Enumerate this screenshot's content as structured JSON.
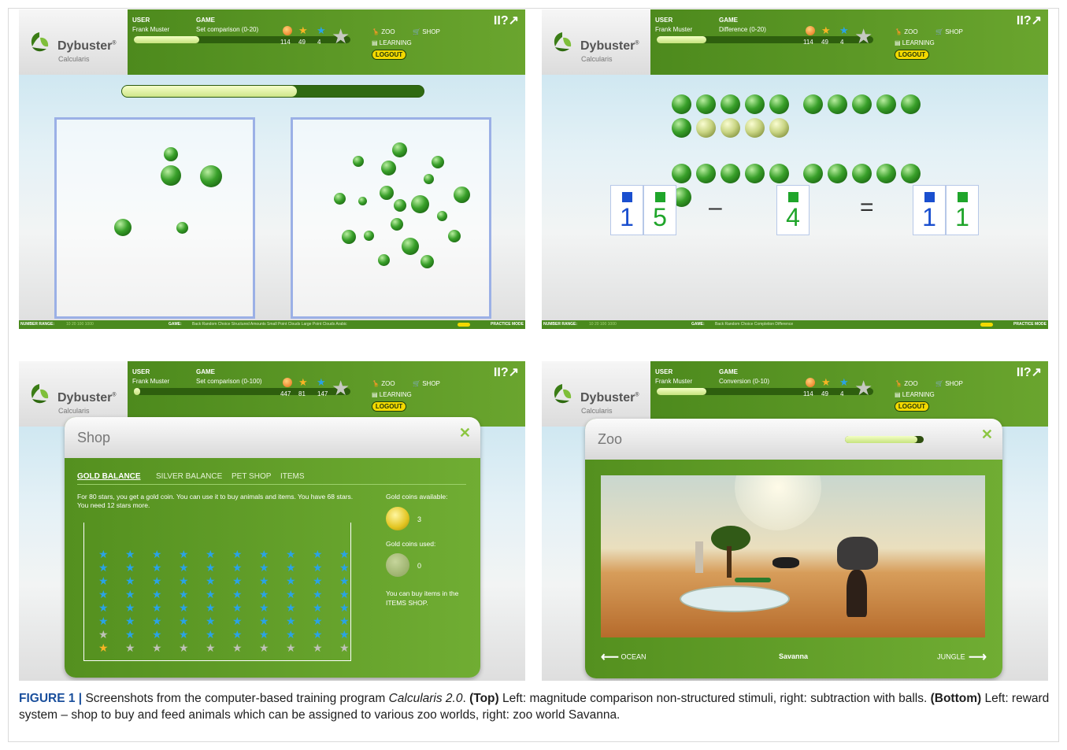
{
  "header": {
    "brand": "Dybuster",
    "brand_mark": "®",
    "subtitle": "Calcularis",
    "user_label": "USER",
    "game_label": "GAME",
    "zoo_label": "ZOO",
    "shop_label": "SHOP",
    "learning_label": "LEARNING",
    "logout_label": "LOGOUT",
    "corner_icons": "II?↗"
  },
  "panels": {
    "tl": {
      "user": "Frank Muster",
      "game": "Set comparison (0-20)",
      "coins": "114",
      "gold_stars": "49",
      "blue_stars": "4",
      "level_progress": 0.3,
      "task_progress": 0.58
    },
    "tr": {
      "user": "Frank Muster",
      "game": "Difference (0-20)",
      "coins": "114",
      "gold_stars": "49",
      "blue_stars": "4",
      "level_progress": 0.23
    },
    "bl": {
      "user": "Frank Muster",
      "game": "Set comparison (0-100)",
      "coins": "447",
      "gold_stars": "81",
      "blue_stars": "147",
      "level_progress": 0.02
    },
    "br": {
      "user": "Frank Muster",
      "game": "Conversion (0-10)",
      "coins": "114",
      "gold_stars": "49",
      "blue_stars": "4",
      "level_progress": 0.23
    }
  },
  "footer_tl": {
    "range_label": "NUMBER RANGE:",
    "range_values": "10  20  100  1000",
    "game_label": "GAME:",
    "game_items": "Back    Random Choice    Structured Amounts    Small Point Clouds    Large Point Clouds    Arabic",
    "mode": "PRACTICE MODE"
  },
  "footer_tr": {
    "range_label": "NUMBER RANGE:",
    "range_values": "10  20  100  1000",
    "game_label": "GAME:",
    "game_items": "Back    Random Choice    Completion    Difference",
    "mode": "PRACTICE MODE"
  },
  "equation": {
    "a1": "1",
    "a2": "5",
    "minus": "–",
    "b": "4",
    "equals": "=",
    "r1": "1",
    "r2": "1"
  },
  "shop": {
    "title": "Shop",
    "tabs": [
      "GOLD BALANCE",
      "SILVER BALANCE",
      "PET SHOP",
      "ITEMS"
    ],
    "text": "For 80 stars, you get a gold coin. You can use it to buy animals and items. You have 68 stars. You need 12 stars more.",
    "available_label": "Gold coins available:",
    "available_value": "3",
    "used_label": "Gold coins used:",
    "used_value": "0",
    "note": "You can buy items in the ITEMS SHOP.",
    "close": "✕"
  },
  "zoo": {
    "title": "Zoo",
    "world": "Savanna",
    "prev": "OCEAN",
    "next": "JUNGLE",
    "close": "✕",
    "progress": 0.92
  },
  "caption": {
    "fig": "FIGURE 1 |",
    "p1": " Screenshots from the computer-based training program ",
    "program": "Calcularis 2.0",
    "p2": ". ",
    "top": "(Top)",
    "p3": " Left: magnitude comparison non-structured stimuli, right: subtraction with balls. ",
    "bottom": "(Bottom)",
    "p4": " Left: reward system – shop to buy and feed animals which can be assigned to various zoo worlds, right: zoo world Savanna."
  },
  "colors": {
    "green": "#5c9a26",
    "blue_card": "#1a4fcf",
    "green_card": "#1fa52a",
    "yellow": "#f3d900"
  }
}
